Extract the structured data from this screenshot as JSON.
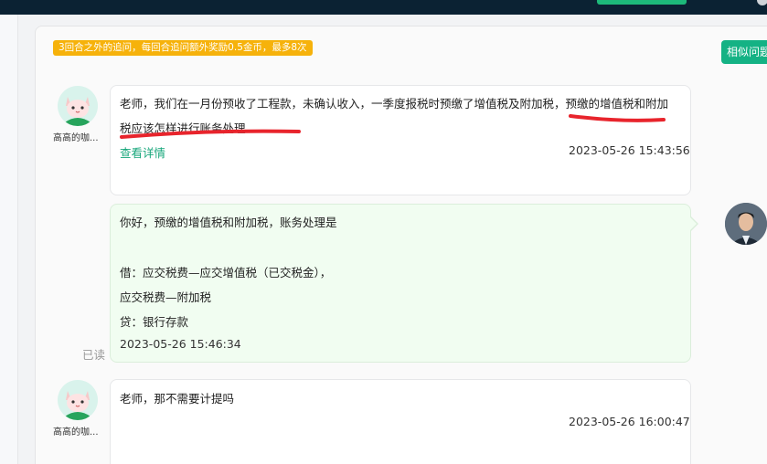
{
  "header": {},
  "notice": {
    "text": "3回合之外的追问，每回合追问额外奖励0.5金币，最多8次"
  },
  "similar_button": {
    "label": "相似问题"
  },
  "messages": [
    {
      "sender": "高高的咖...",
      "lines": [
        "老师，我们在一月份预收了工程款，未确认收入，一季度报税时预缴了增值税及附加税，预缴的增值税和附加",
        "税应该怎样进行账务处理"
      ],
      "link": "查看详情",
      "time": "2023-05-26 15:43:56"
    },
    {
      "lines": [
        "你好，预缴的增值税和附加税，账务处理是",
        "借：应交税费—应交增值税（已交税金），",
        "应交税费—附加税",
        "贷：银行存款"
      ],
      "time": "2023-05-26 15:46:34",
      "status": "已读"
    },
    {
      "sender": "高高的咖...",
      "lines": [
        "老师，那不需要计提吗"
      ],
      "time": "2023-05-26 16:00:47"
    }
  ],
  "colors": {
    "accent": "#14b284",
    "notice": "#f6b20b",
    "highlight": "#e8242c"
  }
}
